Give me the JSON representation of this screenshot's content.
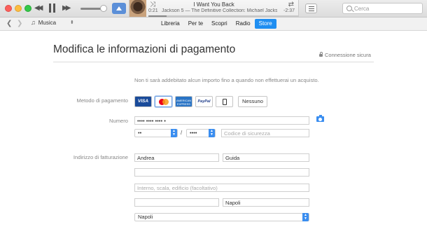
{
  "titlebar": {
    "song_title": "I Want You Back",
    "song_subtitle": "Jackson 5 — The Definitive Collection: Michael Jackson",
    "time_elapsed": "0:21",
    "time_remaining": "-2:37",
    "progress": 0.12,
    "volume": 0.85,
    "search_placeholder": "Cerca"
  },
  "navbar": {
    "media_kind": "Musica",
    "tabs": [
      {
        "label": "Libreria",
        "active": false
      },
      {
        "label": "Per te",
        "active": false
      },
      {
        "label": "Scopri",
        "active": false
      },
      {
        "label": "Radio",
        "active": false
      },
      {
        "label": "Store",
        "active": true
      }
    ]
  },
  "page": {
    "title": "Modifica le informazioni di pagamento",
    "secure_label": "Connessione sicura",
    "note": "Non ti sarà addebitato alcun importo fino a quando non effettuerai un acquisto."
  },
  "payment": {
    "method_label": "Metodo di pagamento",
    "cards": [
      {
        "name": "visa",
        "text": "VISA",
        "selected": false
      },
      {
        "name": "mastercard",
        "text": "",
        "selected": true
      },
      {
        "name": "amex",
        "text": "AMERICAN EXPRESS",
        "selected": false
      },
      {
        "name": "paypal",
        "text": "PayPal",
        "selected": false
      },
      {
        "name": "apple-pay",
        "text": "",
        "selected": false
      }
    ],
    "none_label": "Nessuno",
    "number_label": "Numero",
    "number_value": "•••• •••• •••• •",
    "exp_month": "••",
    "exp_year": "••••",
    "security_code_placeholder": "Codice di sicurezza"
  },
  "billing": {
    "label": "Indirizzo di fatturazione",
    "first_name": "Andrea",
    "last_name": "Guida",
    "address_line1": "",
    "address_line2_placeholder": "Interno, scala, edificio (facoltativo)",
    "postal_code": "",
    "city": "Napoli",
    "province": "Napoli"
  }
}
